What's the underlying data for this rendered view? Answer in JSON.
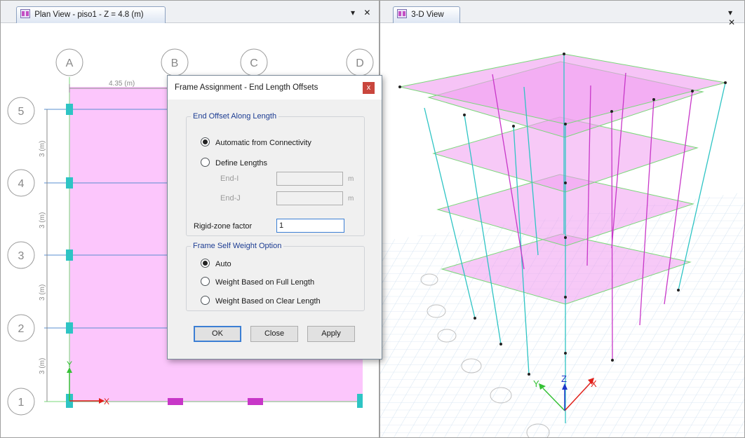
{
  "plan_view": {
    "tab_title": "Plan View - piso1 - Z = 4.8 (m)",
    "grid_columns": [
      "A",
      "B",
      "C",
      "D"
    ],
    "grid_rows": [
      "5",
      "4",
      "3",
      "2",
      "1"
    ],
    "dimension_x": "4.35 (m)",
    "dimension_y": "3 (m)",
    "axis_x": "X",
    "axis_y": "Y"
  },
  "view_3d": {
    "tab_title": "3-D View",
    "axis_x": "X",
    "axis_y": "Y",
    "axis_z": "Z"
  },
  "window_controls": {
    "menu": "▾",
    "close": "✕"
  },
  "dialog": {
    "title": "Frame Assignment - End Length Offsets",
    "close": "x",
    "offset_group": {
      "legend": "End Offset Along Length",
      "option_auto": "Automatic from Connectivity",
      "option_define": "Define Lengths",
      "selected": "auto",
      "end_i_label": "End-I",
      "end_j_label": "End-J",
      "end_i_value": "",
      "end_j_value": "",
      "unit": "m",
      "rigid_zone_label": "Rigid-zone factor",
      "rigid_zone_value": "1"
    },
    "weight_group": {
      "legend": "Frame Self Weight Option",
      "option_auto": "Auto",
      "option_full": "Weight Based on Full Length",
      "option_clear": "Weight Based on Clear Length",
      "selected": "auto"
    },
    "buttons": {
      "ok": "OK",
      "close": "Close",
      "apply": "Apply"
    }
  },
  "colors": {
    "slab_fill": "#fcc6fc",
    "column": "#2ec4c4",
    "beam": "#c837c8",
    "dialog_legend": "#1c3c92",
    "axis_x": "#e0201a",
    "axis_y": "#35c135",
    "axis_z": "#1a35c8"
  }
}
